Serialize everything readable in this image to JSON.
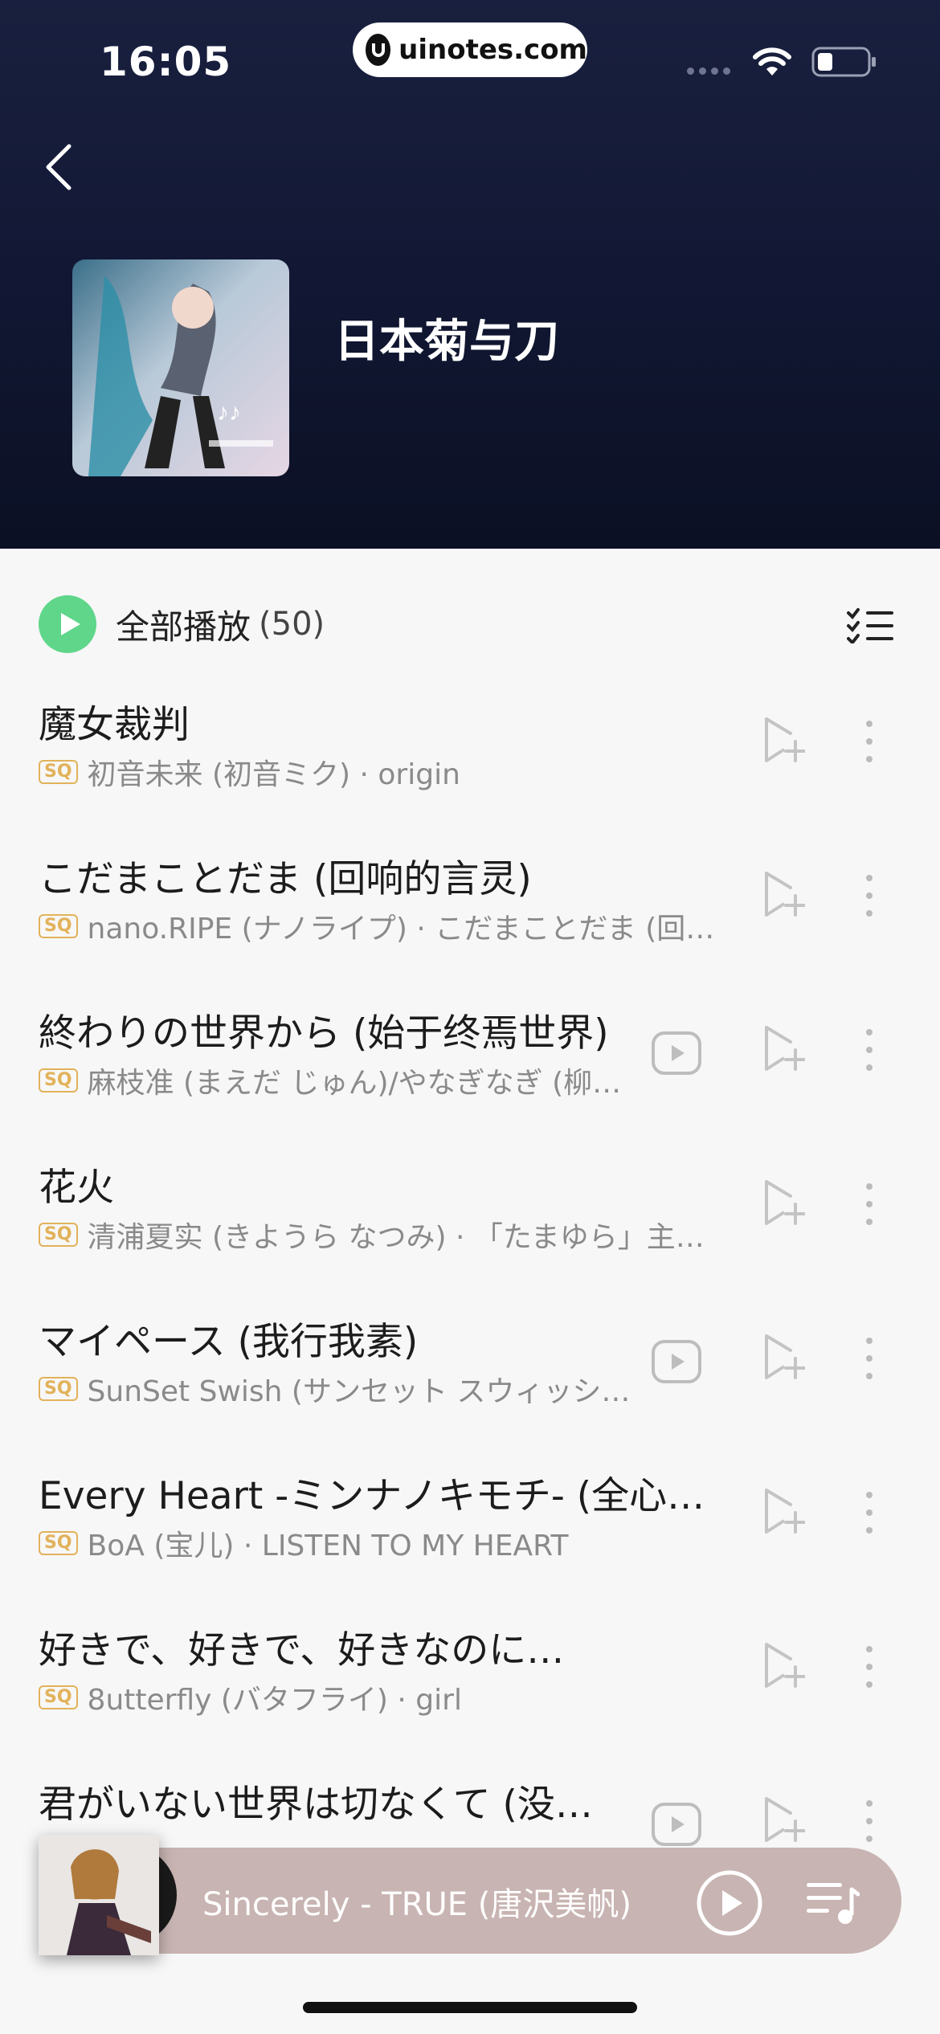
{
  "status_bar": {
    "time": "16:05",
    "url": "uinotes.com"
  },
  "header": {
    "back_icon": "chevron-left-icon",
    "playlist_title": "日本菊与刀"
  },
  "play_all": {
    "label": "全部播放",
    "count": "(50)"
  },
  "quality_badge": "SQ",
  "songs": [
    {
      "title": "魔女裁判",
      "meta": "初音未来 (初音ミク) · origin",
      "has_mv": false
    },
    {
      "title": "こだまことだま (回响的言灵)",
      "meta": "nano.RIPE (ナノライプ) · こだまことだま (回…",
      "has_mv": false
    },
    {
      "title": "終わりの世界から (始于终焉世界)",
      "meta": "麻枝准 (まえだ じゅん)/やなぎなぎ (柳…",
      "has_mv": true
    },
    {
      "title": "花火",
      "meta": "清浦夏实 (きようら なつみ) · 「たまゆら」主…",
      "has_mv": false
    },
    {
      "title": "マイペース (我行我素)",
      "meta": "SunSet Swish (サンセット スウィッシ…",
      "has_mv": true
    },
    {
      "title": "Every Heart -ミンナノキモチ- (全心…",
      "meta": "BoA (宝儿) · LISTEN TO MY HEART",
      "has_mv": false
    },
    {
      "title": "好きで、好きで、好きなのに…",
      "meta": "8utterfly (バタフライ) · girl",
      "has_mv": false
    },
    {
      "title": "君がいない世界は切なくて (没…",
      "meta": "",
      "has_mv": true
    }
  ],
  "player": {
    "now_playing": "Sincerely - TRUE (唐沢美帆)"
  },
  "colors": {
    "accent_green": "#5fd68a",
    "sq_gold": "#e2b25a",
    "player_bg": "#c8b4b2"
  }
}
